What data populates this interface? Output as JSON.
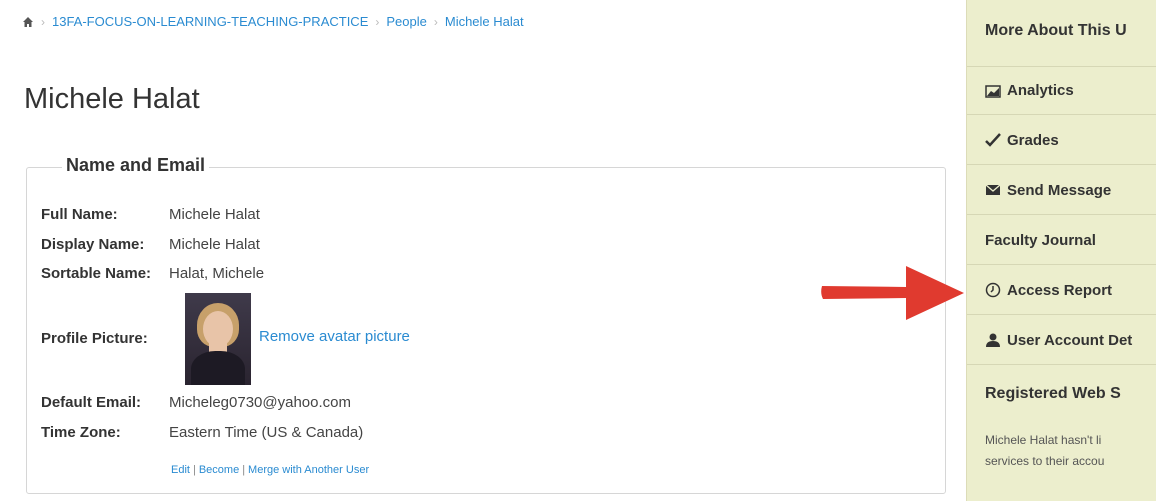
{
  "breadcrumb": {
    "course": "13FA-FOCUS-ON-LEARNING-TEACHING-PRACTICE",
    "people": "People",
    "current": "Michele Halat"
  },
  "page": {
    "title": "Michele Halat"
  },
  "name_email": {
    "legend": "Name and Email",
    "full_name_label": "Full Name:",
    "full_name": "Michele Halat",
    "display_name_label": "Display Name:",
    "display_name": "Michele Halat",
    "sortable_name_label": "Sortable Name:",
    "sortable_name": "Halat, Michele",
    "profile_picture_label": "Profile Picture:",
    "remove_avatar": "Remove avatar picture",
    "default_email_label": "Default Email:",
    "default_email": "Micheleg0730@yahoo.com",
    "time_zone_label": "Time Zone:",
    "time_zone": "Eastern Time (US & Canada)",
    "links": {
      "edit": "Edit",
      "become": "Become",
      "merge": "Merge with Another User"
    }
  },
  "sidebar": {
    "heading": "More About This U",
    "items": [
      {
        "label": "Analytics",
        "icon": "chart-icon"
      },
      {
        "label": "Grades",
        "icon": "checkmark-icon"
      },
      {
        "label": "Send Message",
        "icon": "envelope-icon"
      },
      {
        "label": "Faculty Journal",
        "icon": ""
      },
      {
        "label": "Access Report",
        "icon": "clock-icon"
      },
      {
        "label": "User Account Det",
        "icon": "user-icon"
      }
    ],
    "services_heading": "Registered Web S",
    "services_text_1": "Michele Halat hasn't li",
    "services_text_2": "services to their accou"
  },
  "colors": {
    "link": "#2a8bd1",
    "sidebar_bg": "#eceecd",
    "arrow": "#e03a2f"
  }
}
